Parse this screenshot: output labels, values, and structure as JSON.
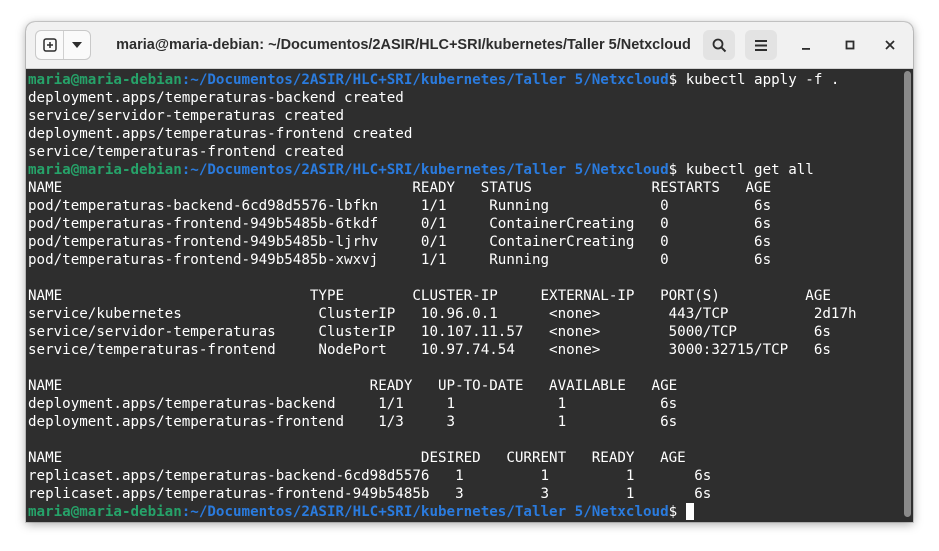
{
  "window": {
    "title": "maria@maria-debian: ~/Documentos/2ASIR/HLC+SRI/kubernetes/Taller 5/Netxcloud",
    "buttons": {
      "new_tab": "new-tab-icon",
      "menu_arrow": "chevron-down-icon",
      "search": "search-icon",
      "hamburger": "hamburger-menu-icon",
      "minimize": "minimize-icon",
      "maximize": "maximize-icon",
      "close": "close-icon"
    }
  },
  "colors": {
    "prompt_user": "#26a269",
    "prompt_path": "#2a7bde",
    "terminal_bg": "#2e2e2e",
    "terminal_fg": "#ffffff"
  },
  "terminal": {
    "prompt_user": "maria@maria-debian",
    "prompt_path": ":~/Documentos/2ASIR/HLC+SRI/kubernetes/Taller 5/Netxcloud",
    "prompt_end": "$ ",
    "lines": [
      {
        "type": "prompt",
        "cmd": "kubectl apply -f ."
      },
      {
        "type": "out",
        "text": "deployment.apps/temperaturas-backend created"
      },
      {
        "type": "out",
        "text": "service/servidor-temperaturas created"
      },
      {
        "type": "out",
        "text": "deployment.apps/temperaturas-frontend created"
      },
      {
        "type": "out",
        "text": "service/temperaturas-frontend created"
      },
      {
        "type": "prompt",
        "cmd": "kubectl get all"
      },
      {
        "type": "out",
        "text": "NAME                                         READY   STATUS              RESTARTS   AGE"
      },
      {
        "type": "out",
        "text": "pod/temperaturas-backend-6cd98d5576-lbfkn     1/1     Running             0          6s"
      },
      {
        "type": "out",
        "text": "pod/temperaturas-frontend-949b5485b-6tkdf     0/1     ContainerCreating   0          6s"
      },
      {
        "type": "out",
        "text": "pod/temperaturas-frontend-949b5485b-ljrhv     0/1     ContainerCreating   0          6s"
      },
      {
        "type": "out",
        "text": "pod/temperaturas-frontend-949b5485b-xwxvj     1/1     Running             0          6s"
      },
      {
        "type": "out",
        "text": ""
      },
      {
        "type": "out",
        "text": "NAME                             TYPE        CLUSTER-IP     EXTERNAL-IP   PORT(S)          AGE"
      },
      {
        "type": "out",
        "text": "service/kubernetes                ClusterIP   10.96.0.1      <none>        443/TCP          2d17h"
      },
      {
        "type": "out",
        "text": "service/servidor-temperaturas     ClusterIP   10.107.11.57   <none>        5000/TCP         6s"
      },
      {
        "type": "out",
        "text": "service/temperaturas-frontend     NodePort    10.97.74.54    <none>        3000:32715/TCP   6s"
      },
      {
        "type": "out",
        "text": ""
      },
      {
        "type": "out",
        "text": "NAME                                    READY   UP-TO-DATE   AVAILABLE   AGE"
      },
      {
        "type": "out",
        "text": "deployment.apps/temperaturas-backend     1/1     1            1           6s"
      },
      {
        "type": "out",
        "text": "deployment.apps/temperaturas-frontend    1/3     3            1           6s"
      },
      {
        "type": "out",
        "text": ""
      },
      {
        "type": "out",
        "text": "NAME                                          DESIRED   CURRENT   READY   AGE"
      },
      {
        "type": "out",
        "text": "replicaset.apps/temperaturas-backend-6cd98d5576   1         1         1       6s"
      },
      {
        "type": "out",
        "text": "replicaset.apps/temperaturas-frontend-949b5485b   3         3         1       6s"
      },
      {
        "type": "prompt",
        "cmd": ""
      }
    ]
  }
}
